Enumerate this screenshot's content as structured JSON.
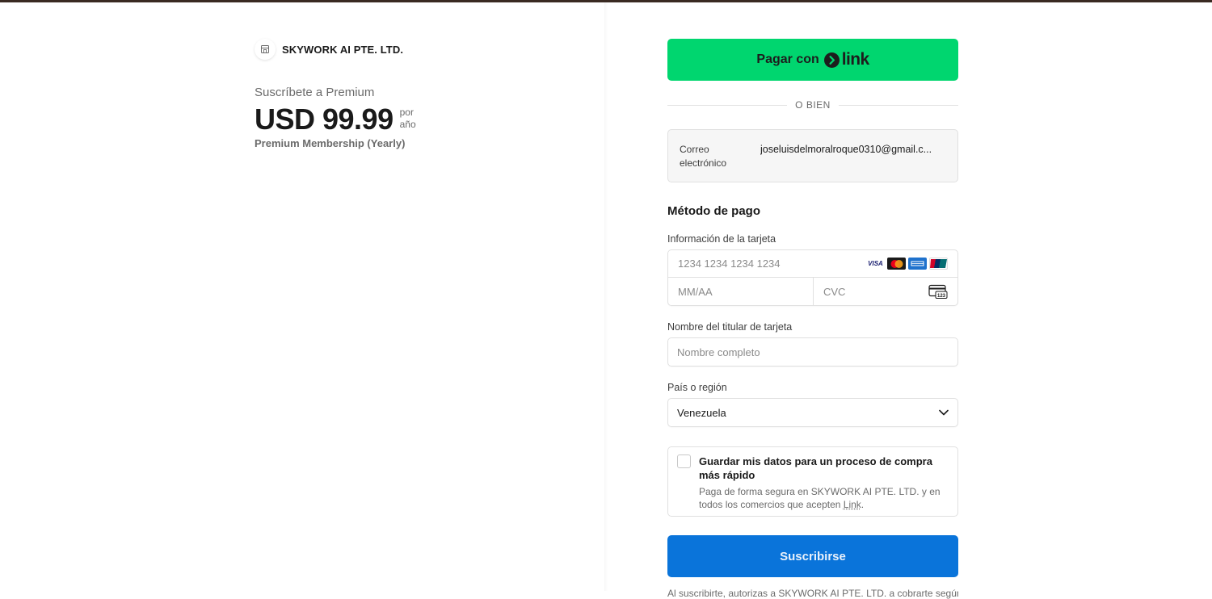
{
  "merchant": {
    "name": "SKYWORK AI PTE. LTD.",
    "logo_icon": "storefront-icon"
  },
  "summary": {
    "subscribe_label": "Suscríbete a Premium",
    "price": "USD 99.99",
    "period_line1": "por",
    "period_line2": "año",
    "product": "Premium Membership (Yearly)"
  },
  "link_button": {
    "label": "Pagar con",
    "logo_text": "link",
    "color": "#00d66f"
  },
  "divider_text": "O BIEN",
  "email": {
    "label_line1": "Correo",
    "label_line2": "electrónico",
    "value": "joseluisdelmoralroque0310@gmail.c..."
  },
  "payment": {
    "title": "Método de pago",
    "card_label": "Información de la tarjeta",
    "card_number_placeholder": "1234 1234 1234 1234",
    "expiry_placeholder": "MM/AA",
    "cvc_placeholder": "CVC",
    "brands": {
      "visa": "VISA",
      "mastercard": "mastercard-icon",
      "amex": "amex-icon",
      "unionpay": "unionpay-icon"
    },
    "cvc_icon_text": "123"
  },
  "cardholder": {
    "label": "Nombre del titular de tarjeta",
    "placeholder": "Nombre completo"
  },
  "country": {
    "label": "País o región",
    "value": "Venezuela"
  },
  "save": {
    "title": "Guardar mis datos para un proceso de compra más rápido",
    "desc_prefix": "Paga de forma segura en SKYWORK AI PTE. LTD. y en todos los comercios que acepten ",
    "desc_link": "Link",
    "desc_suffix": "."
  },
  "subscribe": {
    "label": "Suscribirse",
    "color": "#0a74da"
  },
  "terms": "Al suscribirte, autorizas a SKYWORK AI PTE. LTD. a cobrarte según"
}
